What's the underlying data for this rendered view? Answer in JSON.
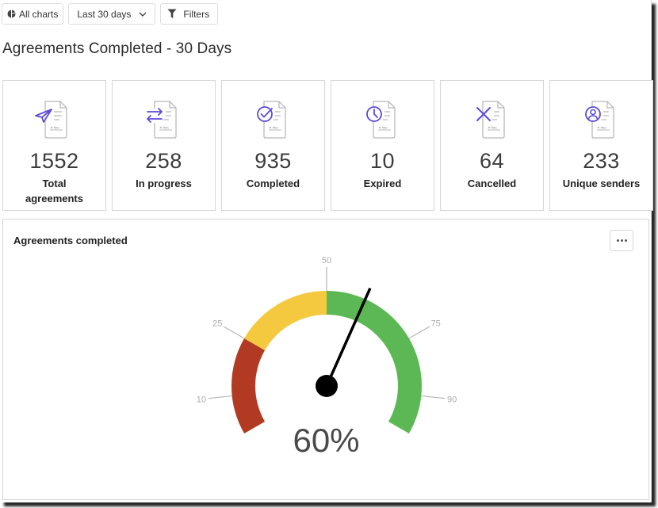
{
  "toolbar": {
    "all_charts_label": "All charts",
    "date_range_label": "Last 30 days",
    "filters_label": "Filters"
  },
  "page": {
    "title": "Agreements Completed - 30 Days"
  },
  "kpis": [
    {
      "icon": "send-icon",
      "value": "1552",
      "label": "Total agreements"
    },
    {
      "icon": "transfer-arrows-icon",
      "value": "258",
      "label": "In progress"
    },
    {
      "icon": "check-circle-icon",
      "value": "935",
      "label": "Completed"
    },
    {
      "icon": "clock-icon",
      "value": "10",
      "label": "Expired"
    },
    {
      "icon": "x-icon",
      "value": "64",
      "label": "Cancelled"
    },
    {
      "icon": "user-circle-icon",
      "value": "233",
      "label": "Unique senders"
    }
  ],
  "colors": {
    "icon_accent": "#5b4bd8",
    "band_red": "#b23a22",
    "band_yellow": "#f5c93f",
    "band_green": "#5bb854",
    "needle": "#000000",
    "tick": "#b5b5b5"
  },
  "panel": {
    "title": "Agreements completed",
    "more_label": "More options"
  },
  "chart_data": {
    "type": "gauge",
    "title": "Agreements completed",
    "value": 60,
    "value_label": "60%",
    "min": 0,
    "max": 100,
    "ticks": [
      10,
      25,
      50,
      75,
      90
    ],
    "tick_labels": [
      "10",
      "25",
      "50",
      "75",
      "90"
    ],
    "bands": [
      {
        "from": 0,
        "to": 25,
        "color": "#b23a22"
      },
      {
        "from": 25,
        "to": 50,
        "color": "#f5c93f"
      },
      {
        "from": 50,
        "to": 100,
        "color": "#5bb854"
      }
    ]
  }
}
